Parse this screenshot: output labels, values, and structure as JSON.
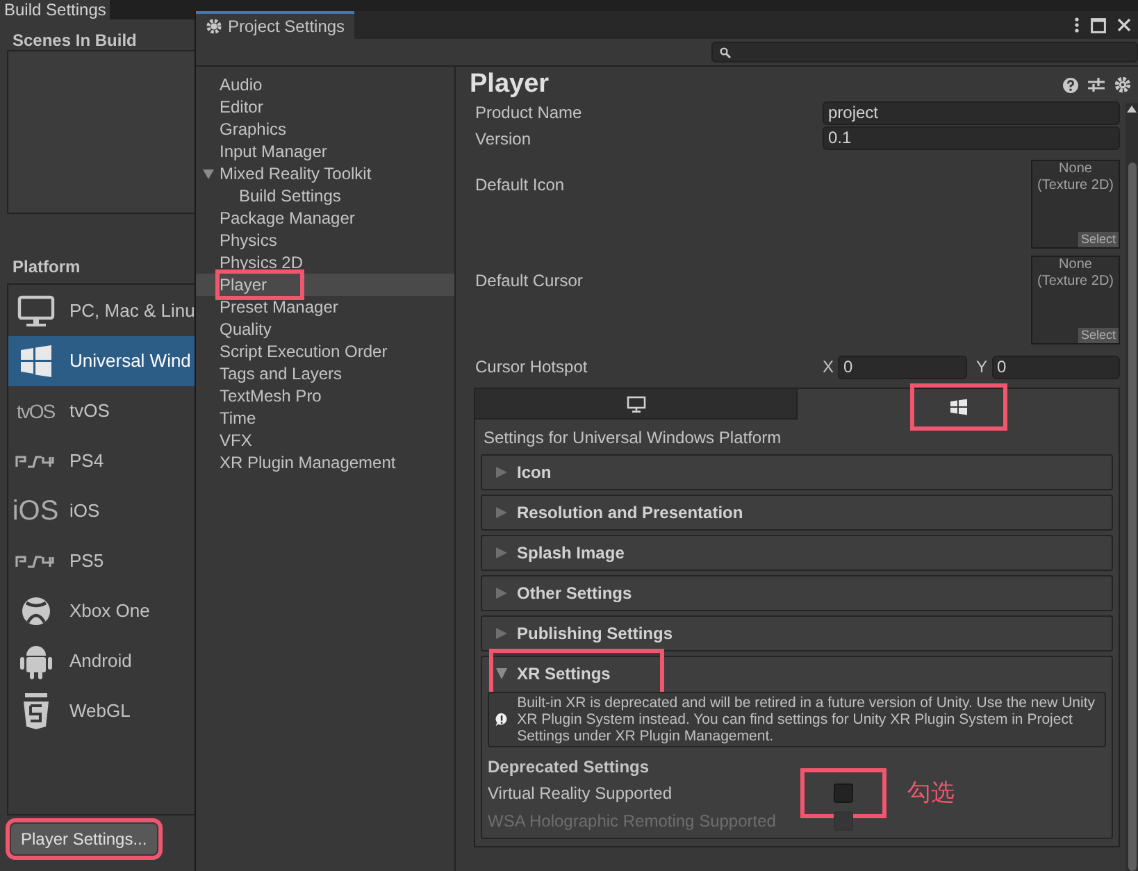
{
  "build_settings": {
    "tab": "Build Settings",
    "scenes_heading": "Scenes In Build",
    "platform_heading": "Platform",
    "platforms": [
      {
        "label": "PC, Mac & Linu",
        "kind": "pc",
        "selected": false
      },
      {
        "label": "Universal Wind",
        "kind": "uwp",
        "selected": true
      },
      {
        "label": "tvOS",
        "kind": "tvos",
        "logo": "tvOS",
        "selected": false
      },
      {
        "label": "PS4",
        "kind": "ps4",
        "selected": false
      },
      {
        "label": "iOS",
        "kind": "ios",
        "logo": "iOS",
        "selected": false
      },
      {
        "label": "PS5",
        "kind": "ps5",
        "selected": false
      },
      {
        "label": "Xbox One",
        "kind": "xbox",
        "selected": false
      },
      {
        "label": "Android",
        "kind": "android",
        "selected": false
      },
      {
        "label": "WebGL",
        "kind": "webgl",
        "selected": false
      }
    ],
    "player_settings_button": {
      "label": "Player Settings...",
      "highlighted": true
    }
  },
  "project_settings": {
    "tab": "Project Settings",
    "categories": [
      {
        "label": "Audio",
        "selected": false,
        "highlighted": false
      },
      {
        "label": "Editor",
        "selected": false,
        "highlighted": false
      },
      {
        "label": "Graphics",
        "selected": false,
        "highlighted": false
      },
      {
        "label": "Input Manager",
        "selected": false,
        "highlighted": false
      },
      {
        "label": "Mixed Reality Toolkit",
        "selected": false,
        "highlighted": false,
        "expanded": true,
        "children": [
          {
            "label": "Build Settings",
            "selected": false,
            "highlighted": false
          }
        ]
      },
      {
        "label": "Package Manager",
        "selected": false,
        "highlighted": false
      },
      {
        "label": "Physics",
        "selected": false,
        "highlighted": false
      },
      {
        "label": "Physics 2D",
        "selected": false,
        "highlighted": false
      },
      {
        "label": "Player",
        "selected": true,
        "highlighted": true
      },
      {
        "label": "Preset Manager",
        "selected": false,
        "highlighted": false
      },
      {
        "label": "Quality",
        "selected": false,
        "highlighted": false
      },
      {
        "label": "Script Execution Order",
        "selected": false,
        "highlighted": false
      },
      {
        "label": "Tags and Layers",
        "selected": false,
        "highlighted": false
      },
      {
        "label": "TextMesh Pro",
        "selected": false,
        "highlighted": false
      },
      {
        "label": "Time",
        "selected": false,
        "highlighted": false
      },
      {
        "label": "VFX",
        "selected": false,
        "highlighted": false
      },
      {
        "label": "XR Plugin Management",
        "selected": false,
        "highlighted": false
      }
    ],
    "inspector": {
      "title": "Player",
      "fields": [
        {
          "kind": "text",
          "label": "Product Name",
          "value": "project"
        },
        {
          "kind": "text",
          "label": "Version",
          "value": "0.1"
        },
        {
          "kind": "texture",
          "label": "Default Icon",
          "value": "None",
          "type": "(Texture 2D)",
          "button": "Select"
        },
        {
          "kind": "texture",
          "label": "Default Cursor",
          "value": "None",
          "type": "(Texture 2D)",
          "button": "Select"
        },
        {
          "kind": "vector",
          "label": "Cursor Hotspot",
          "x_label": "X",
          "x_value": "0",
          "y_label": "Y",
          "y_value": "0"
        }
      ],
      "platform_tabs": [
        {
          "kind": "desktop",
          "selected": false,
          "highlighted": false
        },
        {
          "kind": "windows",
          "selected": true,
          "highlighted": true
        }
      ],
      "platform_caption": "Settings for Universal Windows Platform",
      "sections": [
        {
          "label": "Icon",
          "expanded": false,
          "highlighted": false
        },
        {
          "label": "Resolution and Presentation",
          "expanded": false,
          "highlighted": false
        },
        {
          "label": "Splash Image",
          "expanded": false,
          "highlighted": false
        },
        {
          "label": "Other Settings",
          "expanded": false,
          "highlighted": false
        },
        {
          "label": "Publishing Settings",
          "expanded": false,
          "highlighted": false
        },
        {
          "label": "XR Settings",
          "expanded": true,
          "highlighted": true
        }
      ],
      "xr": {
        "help": "Built-in XR is deprecated and will be retired in a future version of Unity. Use the new Unity XR Plugin System instead. You can find settings for Unity XR Plugin System in Project Settings under XR Plugin Management.",
        "group_heading": "Deprecated Settings",
        "options": [
          {
            "label": "Virtual Reality Supported",
            "checked": false,
            "disabled": false,
            "highlighted": true
          },
          {
            "label": "WSA Holographic Remoting Supported",
            "checked": false,
            "disabled": true,
            "highlighted": false
          }
        ]
      }
    },
    "annotation": "勾选"
  }
}
